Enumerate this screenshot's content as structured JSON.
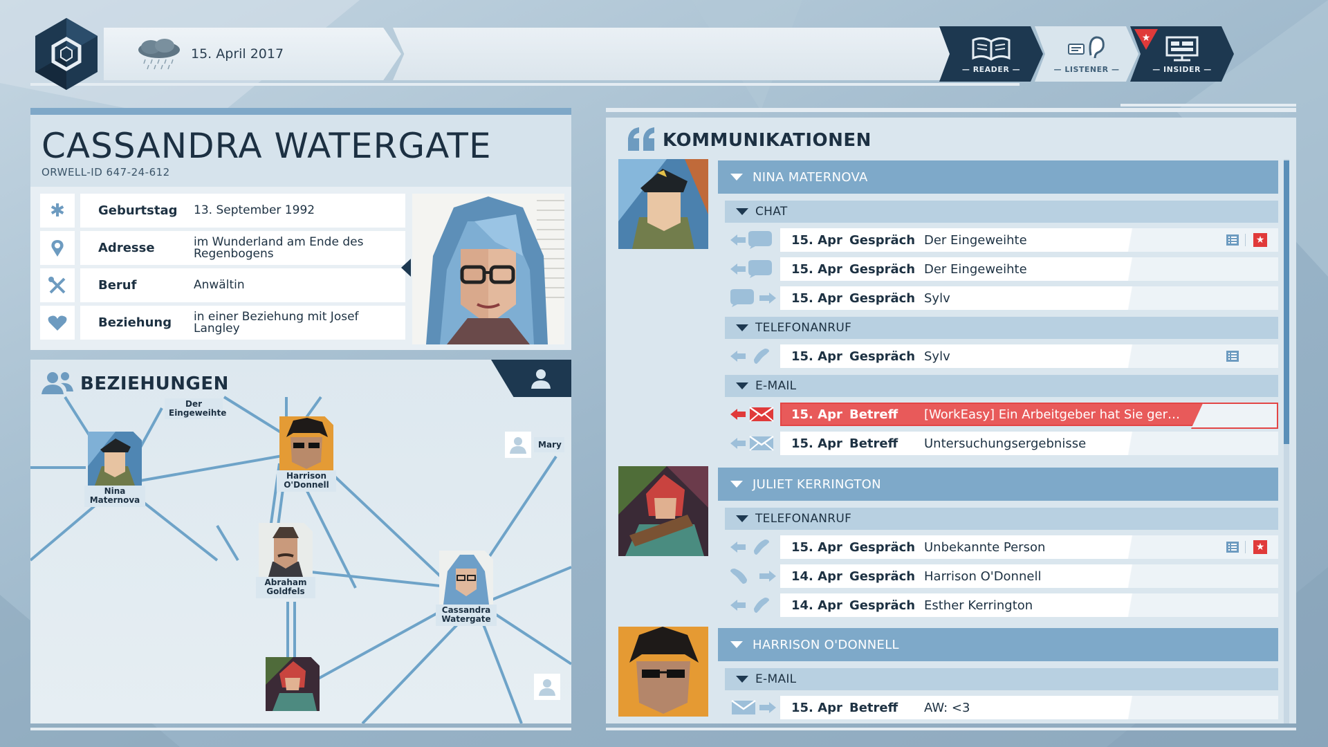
{
  "header": {
    "date": "15. April 2017",
    "modes": [
      {
        "label": "— READER —",
        "icon": "book-icon"
      },
      {
        "label": "— LISTENER —",
        "icon": "ear-icon"
      },
      {
        "label": "— INSIDER —",
        "icon": "monitor-icon"
      }
    ]
  },
  "profile": {
    "name": "CASSANDRA WATERGATE",
    "orwell_id": "ORWELL-ID  647-24-612",
    "fields": [
      {
        "key": "Geburtstag",
        "value": "13. September 1992",
        "icon": "asterisk-icon"
      },
      {
        "key": "Adresse",
        "value": "im Wunderland am Ende des Regenbogens",
        "icon": "location-pin-icon"
      },
      {
        "key": "Beruf",
        "value": "Anwältin",
        "icon": "tools-icon"
      },
      {
        "key": "Beziehung",
        "value": "in einer Beziehung mit Josef Langley",
        "icon": "heart-icon"
      }
    ]
  },
  "relationships": {
    "title": "BEZIEHUNGEN",
    "nodes": [
      {
        "label": "Nina Maternova"
      },
      {
        "label": "Harrison O'Donnell"
      },
      {
        "label": "Abraham Goldfels"
      },
      {
        "label": "Cassandra Watergate"
      }
    ],
    "tags": [
      "Der Eingeweihte",
      "Mary"
    ]
  },
  "communications": {
    "title": "KOMMUNIKATIONEN",
    "contacts": [
      {
        "name": "NINA MATERNOVA",
        "groups": [
          {
            "category": "CHAT",
            "items": [
              {
                "date": "15. Apr",
                "type": "Gespräch",
                "subject": "Der Eingeweihte"
              },
              {
                "date": "15. Apr",
                "type": "Gespräch",
                "subject": "Der Eingeweihte"
              },
              {
                "date": "15. Apr",
                "type": "Gespräch",
                "subject": "Sylv"
              }
            ]
          },
          {
            "category": "TELEFONANRUF",
            "items": [
              {
                "date": "15. Apr",
                "type": "Gespräch",
                "subject": "Sylv"
              }
            ]
          },
          {
            "category": "E-MAIL",
            "items": [
              {
                "date": "15. Apr",
                "type": "Betreff",
                "subject": "[WorkEasy] Ein Arbeitgeber hat Sie ger…"
              },
              {
                "date": "15. Apr",
                "type": "Betreff",
                "subject": "Untersuchungsergebnisse"
              }
            ]
          }
        ]
      },
      {
        "name": "JULIET KERRINGTON",
        "groups": [
          {
            "category": "TELEFONANRUF",
            "items": [
              {
                "date": "15. Apr",
                "type": "Gespräch",
                "subject": "Unbekannte Person"
              },
              {
                "date": "14. Apr",
                "type": "Gespräch",
                "subject": "Harrison O'Donnell"
              },
              {
                "date": "14. Apr",
                "type": "Gespräch",
                "subject": "Esther Kerrington"
              }
            ]
          }
        ]
      },
      {
        "name": "HARRISON O'DONNELL",
        "groups": [
          {
            "category": "E-MAIL",
            "items": [
              {
                "date": "15. Apr",
                "type": "Betreff",
                "subject": "AW: <3"
              }
            ]
          }
        ]
      }
    ]
  },
  "colors": {
    "accent_dark": "#1d3850",
    "accent_blue": "#7ea9c9",
    "highlight_red": "#e34545"
  }
}
